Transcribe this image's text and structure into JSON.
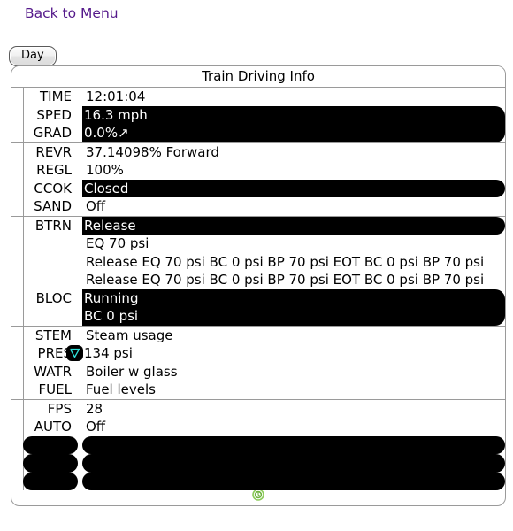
{
  "nav": {
    "back_link": "Back to Menu"
  },
  "toolbar": {
    "day_button": "Day"
  },
  "panel": {
    "title": "Train Driving Info"
  },
  "colors": {
    "link": "#551a8b",
    "highlight_bg": "#000000",
    "highlight_text": "#ffffff",
    "grade_text": "#f5f500",
    "state_text": "#2ee0d8",
    "footer_icon": "#7cc24a",
    "panel_border": "#9a9a9a"
  },
  "groups": [
    {
      "name": "time-speed-grade",
      "rows": [
        {
          "label": "TIME",
          "value": "12:01:04",
          "highlight": false
        },
        {
          "label": "SPED",
          "value": "16.3 mph",
          "highlight": true
        },
        {
          "label": "GRAD",
          "value": "0.0%↗",
          "highlight": true,
          "value_color": "grade"
        }
      ]
    },
    {
      "name": "controls",
      "rows": [
        {
          "label": "REVR",
          "value": "37.14098% Forward",
          "highlight": false
        },
        {
          "label": "REGL",
          "value": "100%",
          "highlight": false
        },
        {
          "label": "CCOK",
          "value": "Closed",
          "highlight": true
        },
        {
          "label": "SAND",
          "value": "Off",
          "highlight": false
        }
      ]
    },
    {
      "name": "brakes",
      "rows": [
        {
          "label": "BTRN",
          "value": "Release",
          "highlight": true,
          "value_color": "state"
        },
        {
          "label": "",
          "value": "EQ 70 psi",
          "highlight": false
        },
        {
          "label": "",
          "value": "Release EQ 70 psi BC 0 psi BP 70 psi EOT BC 0 psi BP 70 psi",
          "highlight": false
        },
        {
          "label": "",
          "value": "Release EQ 70 psi BC 0 psi BP 70 psi EOT BC 0 psi BP 70 psi",
          "highlight": false
        },
        {
          "label": "BLOC",
          "value": "Running",
          "highlight": true,
          "value_color": "state"
        },
        {
          "label": "",
          "value": "BC 0 psi",
          "highlight": true
        }
      ]
    },
    {
      "name": "steam-boiler",
      "rows": [
        {
          "label": "STEM",
          "value": "Steam usage",
          "highlight": false
        },
        {
          "label": "PRES",
          "value": "134 psi",
          "highlight": false,
          "badge": "pressure-down-icon"
        },
        {
          "label": "WATR",
          "value": "Boiler w glass",
          "highlight": false
        },
        {
          "label": "FUEL",
          "value": "Fuel levels",
          "highlight": false
        }
      ]
    },
    {
      "name": "system",
      "rows": [
        {
          "label": "FPS",
          "value": "28",
          "highlight": false
        },
        {
          "label": "AUTO",
          "value": "Off",
          "highlight": false
        },
        {
          "label": "",
          "value": "",
          "blank": true
        },
        {
          "label": "",
          "value": "",
          "blank": true
        },
        {
          "label": "",
          "value": "",
          "blank": true
        }
      ]
    }
  ],
  "footer": {
    "icon": "status-circle-icon"
  }
}
